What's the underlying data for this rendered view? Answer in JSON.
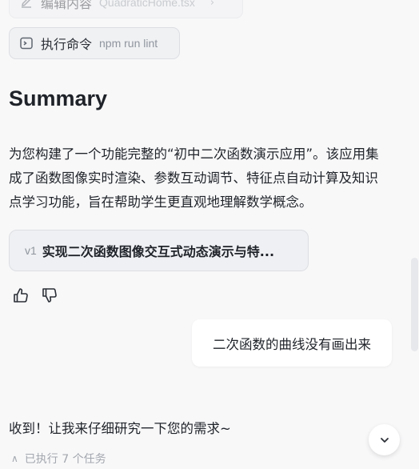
{
  "tool_calls": [
    {
      "label": "编辑内容",
      "argument": "QuadraticHome.tsx",
      "icon": "pencil-icon"
    },
    {
      "label": "执行命令",
      "argument": "npm run lint",
      "icon": "terminal-icon"
    }
  ],
  "summary": {
    "heading": "Summary",
    "body": "为您构建了一个功能完整的“初中二次函数演示应用”。该应用集成了函数图像实时渲染、参数互动调节、特征点自动计算及知识点学习功能，旨在帮助学生更直观地理解数学概念。"
  },
  "version_card": {
    "tag": "v1",
    "title": "实现二次函数图像交互式动态演示与特..."
  },
  "feedback": {
    "like_icon": "thumbs-up-icon",
    "dislike_icon": "thumbs-down-icon"
  },
  "user_message": "二次函数的曲线没有画出来",
  "assistant_reply": "收到！让我来仔细研究一下您的需求~",
  "task_summary": "已执行 7 个任务",
  "colors": {
    "background": "#f8f8f9",
    "chip_bg": "#f0f1f3",
    "text": "#1f2329",
    "muted": "#8f959e"
  }
}
